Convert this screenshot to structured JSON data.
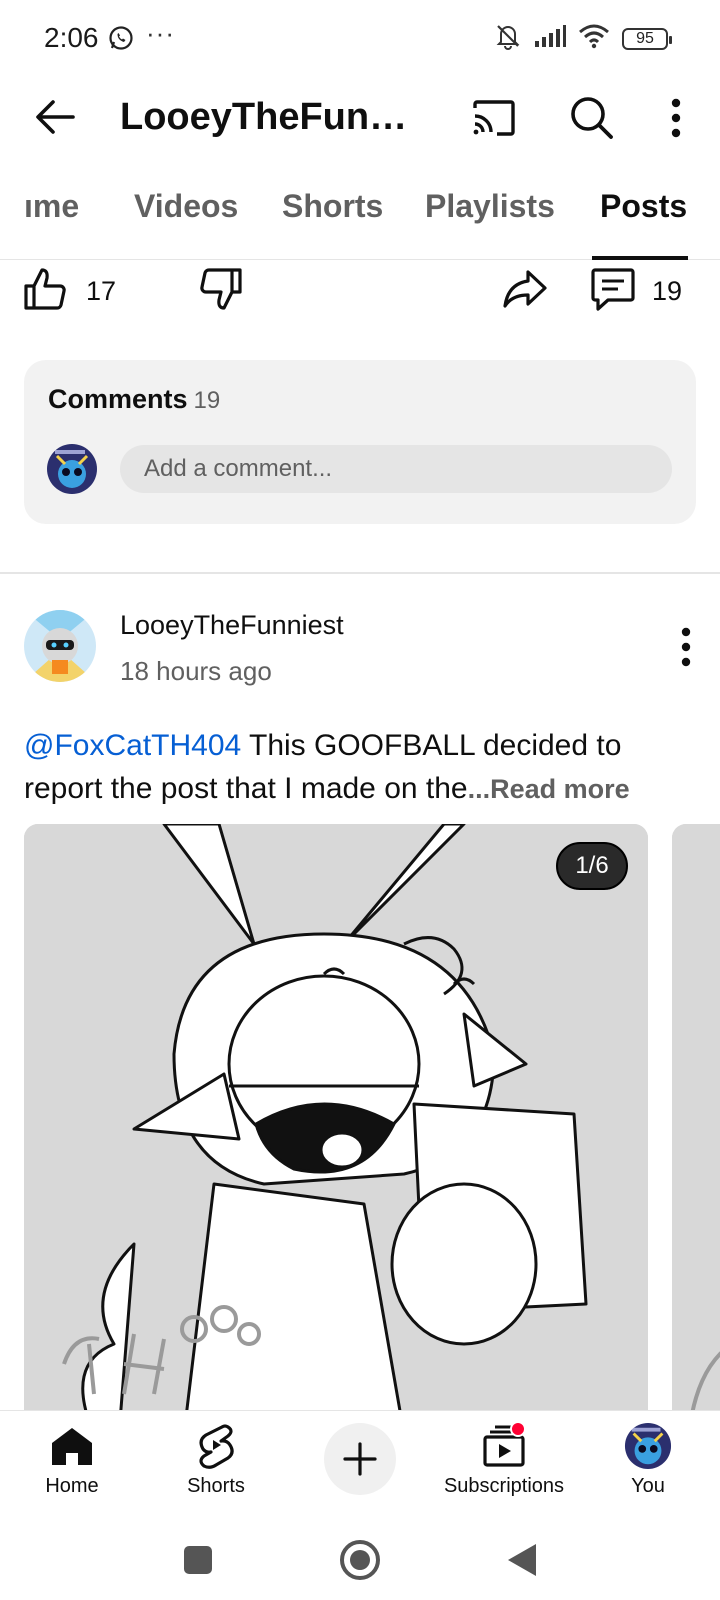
{
  "status_bar": {
    "time": "2:06",
    "battery": "95",
    "more_indicator": "···",
    "icons": [
      "whatsapp-icon",
      "bell-off-icon",
      "signal-icon",
      "wifi-icon",
      "battery-icon"
    ]
  },
  "app_bar": {
    "title": "LooeyTheFunni...",
    "icons": [
      "back-arrow-icon",
      "cast-icon",
      "search-icon",
      "more-vert-icon"
    ]
  },
  "tabs": [
    {
      "label": "ıme"
    },
    {
      "label": "Videos"
    },
    {
      "label": "Shorts"
    },
    {
      "label": "Playlists"
    },
    {
      "label": "Posts",
      "active": true
    }
  ],
  "actions": {
    "likes": "17",
    "comments": "19",
    "icons": [
      "thumbs-up-icon",
      "thumbs-down-icon",
      "share-icon",
      "comment-icon"
    ]
  },
  "comments_card": {
    "title": "Comments",
    "count": "19",
    "placeholder": "Add a comment..."
  },
  "post": {
    "author": "LooeyTheFunniest",
    "time_ago": "18 hours ago",
    "mention": "@FoxCatTH404",
    "text": " This GOOFBALL decided to report the post that I made on the",
    "read_more": "...Read more",
    "image_counter": "1/6"
  },
  "bottom_nav": {
    "items": [
      {
        "label": "Home",
        "icon": "home-icon"
      },
      {
        "label": "Shorts",
        "icon": "shorts-icon"
      },
      {
        "label": "Subscriptions",
        "icon": "subscriptions-icon"
      },
      {
        "label": "You",
        "icon": "avatar"
      }
    ],
    "create_icon": "plus-icon"
  },
  "system_nav": [
    "recents-icon",
    "home-circle-icon",
    "back-triangle-icon"
  ],
  "colors": {
    "accent_link": "#065fd4",
    "notification_dot": "#ff0033",
    "card_bg": "#f2f2f2",
    "secondary_text": "#606060"
  }
}
